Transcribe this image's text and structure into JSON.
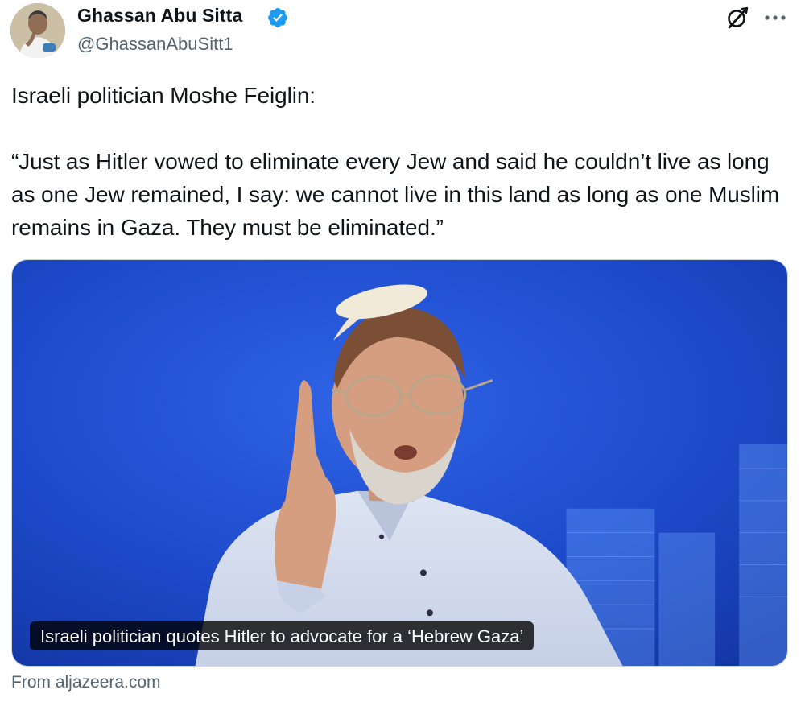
{
  "author": {
    "display_name": "Ghassan Abu Sitta",
    "handle": "@GhassanAbuSitt1",
    "verified": true
  },
  "header_icons": [
    "grok-icon",
    "more-icon"
  ],
  "tweet": {
    "text": "Israeli politician Moshe Feiglin:\n\n“Just as Hitler vowed to eliminate every Jew and said he couldn’t live as long as one Jew remained, I say: we cannot live in this land as long as one Muslim remains in Gaza. They must be eliminated.”"
  },
  "card": {
    "title": "Israeli politician quotes Hitler to advocate for a ‘Hebrew Gaza’",
    "source": "From aljazeera.com"
  },
  "colors": {
    "text": "#0f1419",
    "secondary": "#536471",
    "verified": "#1d9bf0",
    "card_border": "#cfd9de",
    "studio_blue": "#1f4fd1"
  }
}
